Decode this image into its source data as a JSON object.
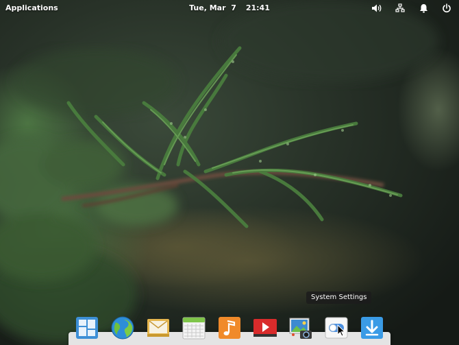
{
  "topbar": {
    "applications_label": "Applications",
    "date": "Tue, Mar  7",
    "time": "21:41",
    "indicators": [
      {
        "icon": "volume-icon"
      },
      {
        "icon": "network-icon"
      },
      {
        "icon": "notifications-bell-icon"
      },
      {
        "icon": "power-icon"
      }
    ]
  },
  "tooltip": {
    "text": "System Settings"
  },
  "dock": {
    "items": [
      {
        "name": "Multitasking View",
        "icon": "multitasking-view-icon"
      },
      {
        "name": "Web Browser",
        "icon": "web-browser-globe-icon"
      },
      {
        "name": "Mail",
        "icon": "mail-envelope-icon"
      },
      {
        "name": "Calendar",
        "icon": "calendar-icon"
      },
      {
        "name": "Music",
        "icon": "music-note-icon"
      },
      {
        "name": "Videos",
        "icon": "videos-play-icon"
      },
      {
        "name": "Photos",
        "icon": "photos-camera-icon"
      },
      {
        "name": "System Settings",
        "icon": "system-settings-toggle-icon"
      },
      {
        "name": "AppCenter",
        "icon": "appcenter-download-icon"
      }
    ]
  },
  "colors": {
    "dock_background": "#e4e4e4",
    "panel_text": "#ffffff",
    "tooltip_background": "#1c1c1c"
  }
}
